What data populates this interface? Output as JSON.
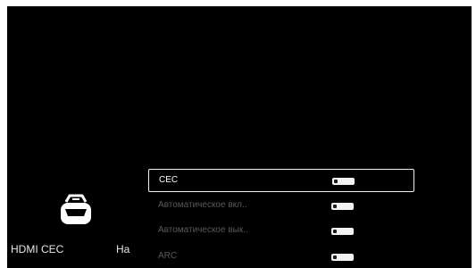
{
  "categories": [
    {
      "label": "HDMI CEC",
      "icon": "hdmi-port-icon"
    },
    {
      "label": "На"
    }
  ],
  "settings": [
    {
      "label": "CEC",
      "state": "off",
      "selected": true,
      "enabled": true
    },
    {
      "label": "Автоматическое вкл..",
      "state": "off",
      "selected": false,
      "enabled": false
    },
    {
      "label": "Автоматическое вык..",
      "state": "off",
      "selected": false,
      "enabled": false
    },
    {
      "label": "ARC",
      "state": "off",
      "selected": false,
      "enabled": false
    }
  ],
  "colors": {
    "background": "#000000",
    "text_primary": "#ffffff",
    "text_disabled": "#595959",
    "toggle_track": "#f2f2f2",
    "focus_border": "#f0f0f0"
  }
}
